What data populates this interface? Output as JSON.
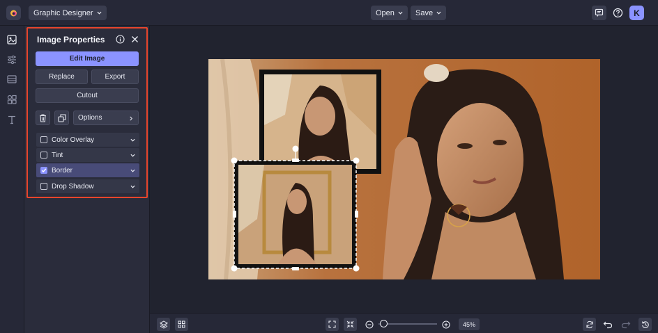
{
  "topbar": {
    "app_menu_label": "Graphic Designer",
    "open_label": "Open",
    "save_label": "Save",
    "avatar_initial": "K"
  },
  "panel": {
    "title": "Image Properties",
    "edit_image_label": "Edit Image",
    "replace_label": "Replace",
    "export_label": "Export",
    "cutout_label": "Cutout",
    "options_label": "Options",
    "sections": [
      {
        "label": "Color Overlay",
        "checked": false
      },
      {
        "label": "Tint",
        "checked": false
      },
      {
        "label": "Border",
        "checked": true
      },
      {
        "label": "Drop Shadow",
        "checked": false
      }
    ]
  },
  "bottombar": {
    "zoom_label": "45%",
    "zoom_level": 0.45
  },
  "colors": {
    "accent": "#8b93ff",
    "highlight_border": "#e8452c",
    "background": "#21232f"
  }
}
